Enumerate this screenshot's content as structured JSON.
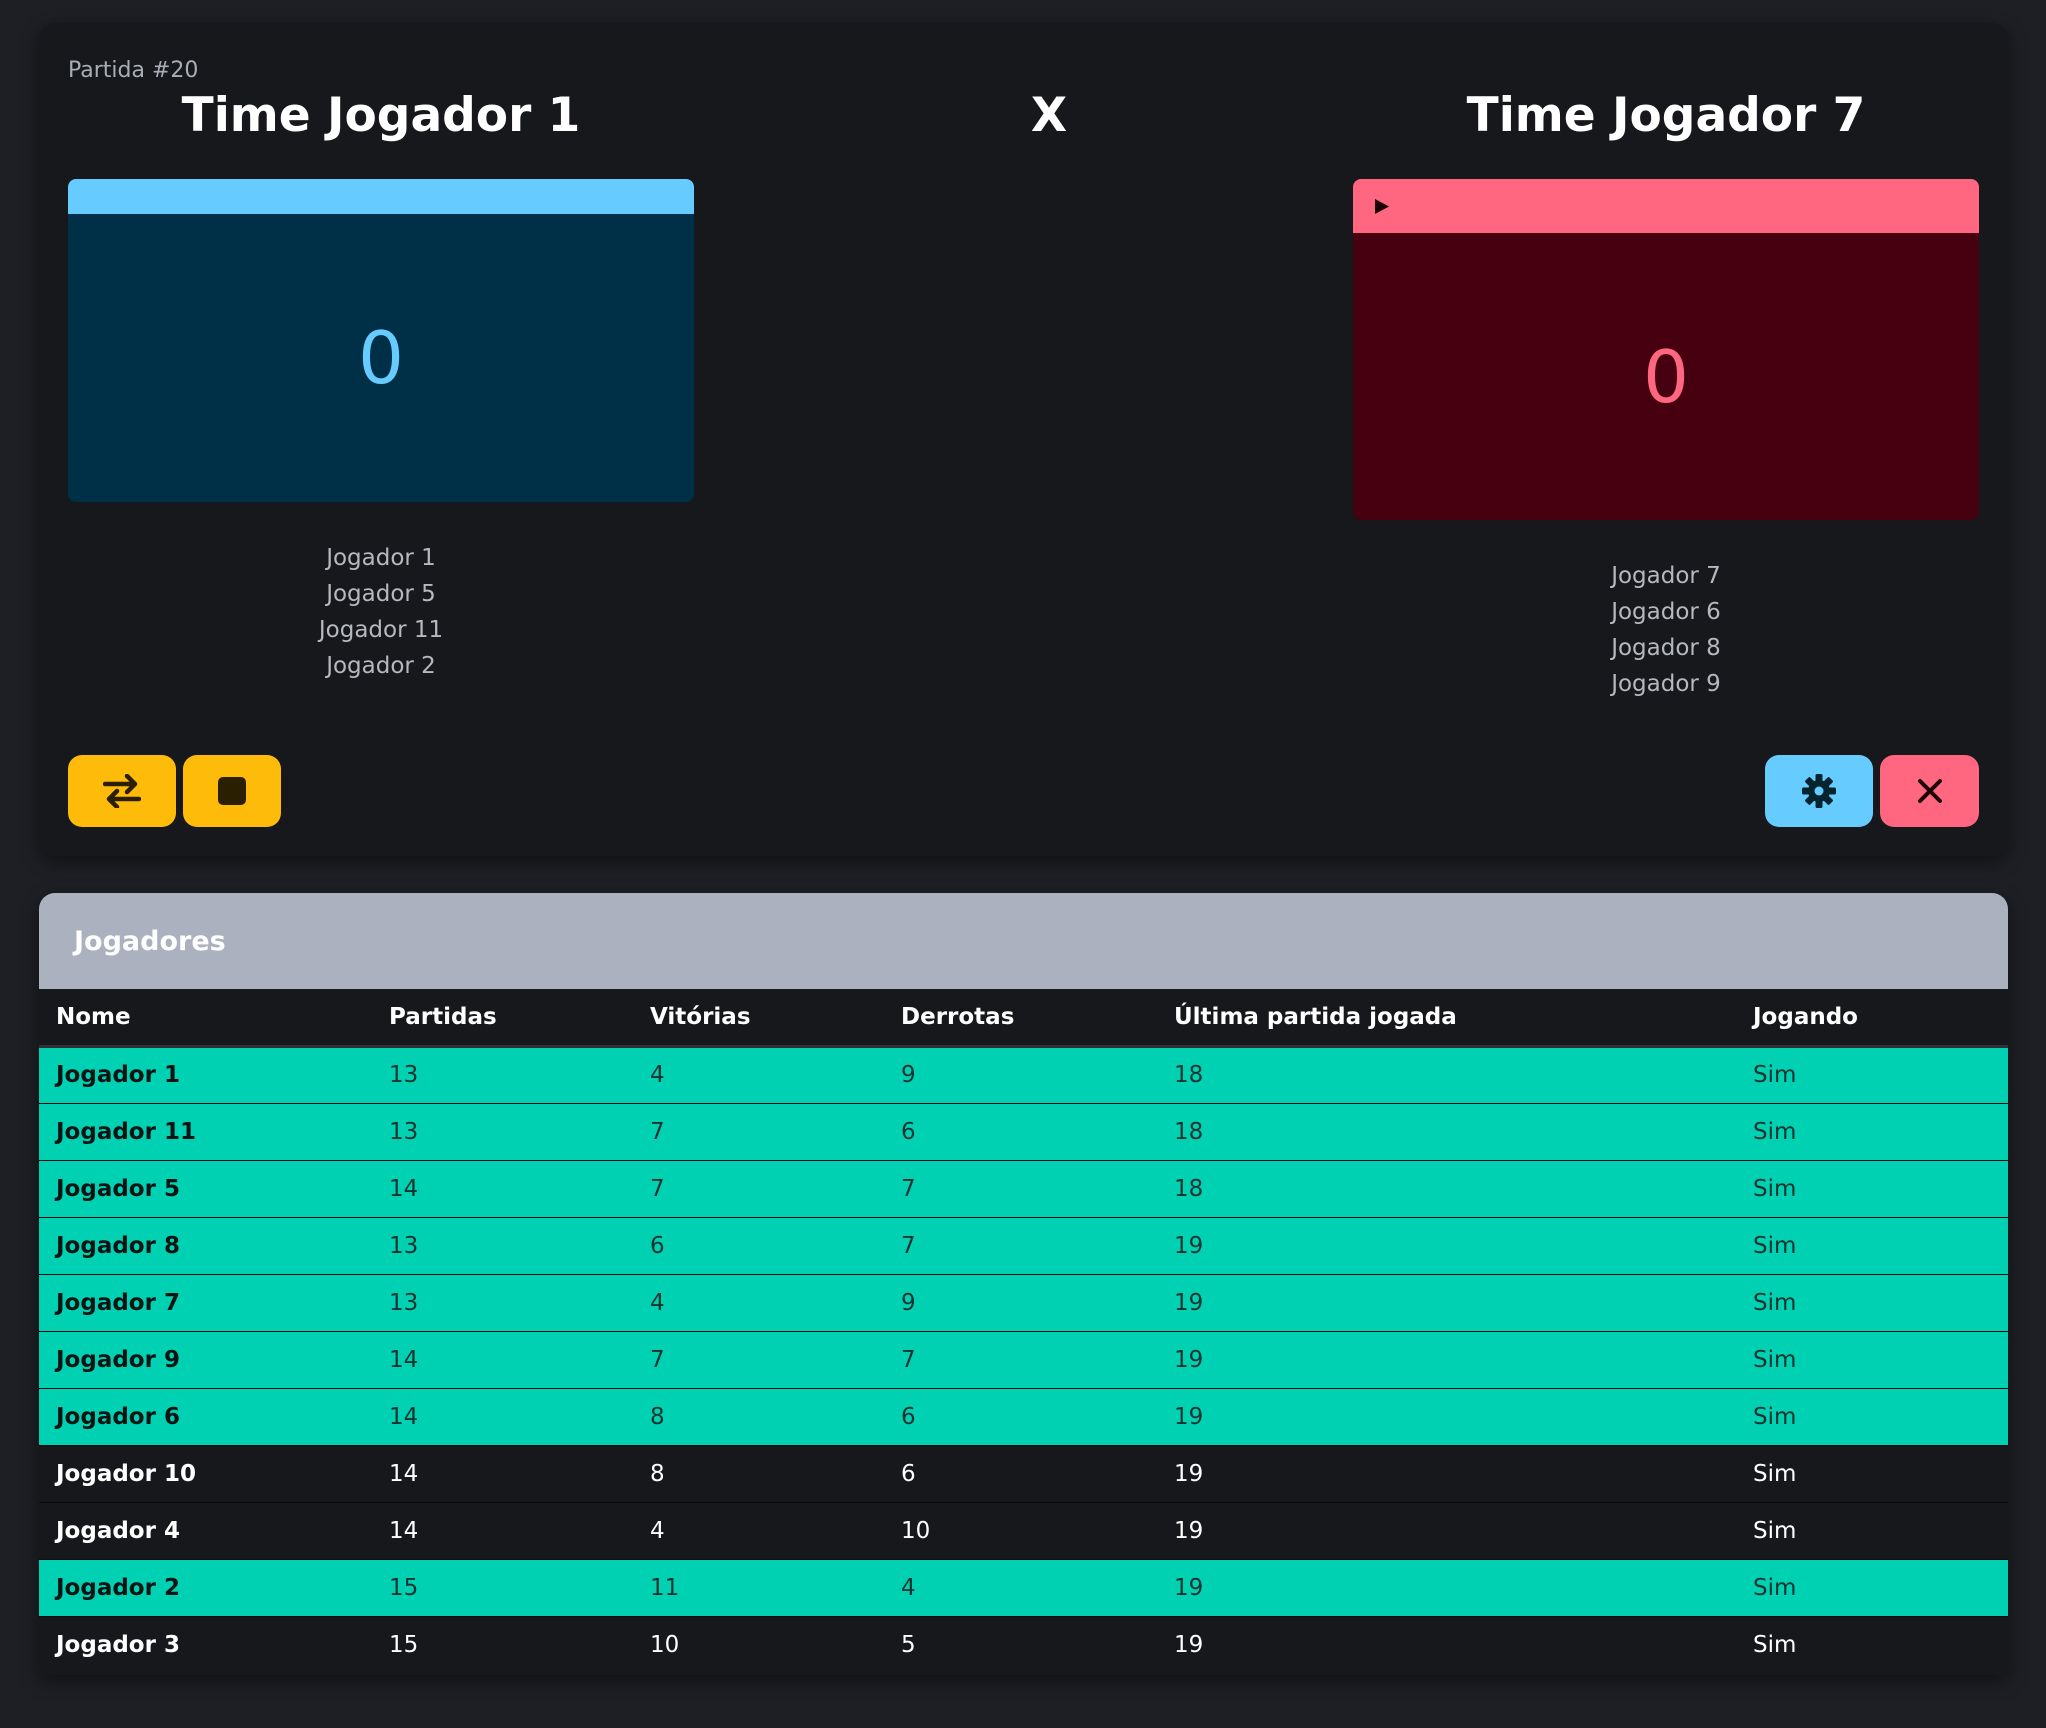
{
  "match": {
    "number_label": "Partida #20",
    "versus_label": "X",
    "team_a": {
      "title": "Time Jogador 1",
      "score": "0",
      "players": [
        "Jogador 1",
        "Jogador 5",
        "Jogador 11",
        "Jogador 2"
      ],
      "bar_color": "#66ccff",
      "body_color": "#003047",
      "score_color": "#66ccff"
    },
    "team_b": {
      "title": "Time Jogador 7",
      "score": "0",
      "serving": true,
      "players": [
        "Jogador 7",
        "Jogador 6",
        "Jogador 8",
        "Jogador 9"
      ],
      "bar_color": "#ff6680",
      "body_color": "#470010",
      "score_color": "#ff6680"
    },
    "buttons": {
      "swap_icon": "swap-arrows-icon",
      "stop_icon": "stop-icon",
      "settings_icon": "gear-icon",
      "close_icon": "close-icon"
    }
  },
  "players_table": {
    "title": "Jogadores",
    "columns": [
      "Nome",
      "Partidas",
      "Vitórias",
      "Derrotas",
      "Última partida jogada",
      "Jogando"
    ],
    "rows": [
      {
        "nome": "Jogador 1",
        "partidas": "13",
        "vitorias": "4",
        "derrotas": "9",
        "ultima": "18",
        "jogando": "Sim",
        "in_match": true
      },
      {
        "nome": "Jogador 11",
        "partidas": "13",
        "vitorias": "7",
        "derrotas": "6",
        "ultima": "18",
        "jogando": "Sim",
        "in_match": true
      },
      {
        "nome": "Jogador 5",
        "partidas": "14",
        "vitorias": "7",
        "derrotas": "7",
        "ultima": "18",
        "jogando": "Sim",
        "in_match": true
      },
      {
        "nome": "Jogador 8",
        "partidas": "13",
        "vitorias": "6",
        "derrotas": "7",
        "ultima": "19",
        "jogando": "Sim",
        "in_match": true
      },
      {
        "nome": "Jogador 7",
        "partidas": "13",
        "vitorias": "4",
        "derrotas": "9",
        "ultima": "19",
        "jogando": "Sim",
        "in_match": true
      },
      {
        "nome": "Jogador 9",
        "partidas": "14",
        "vitorias": "7",
        "derrotas": "7",
        "ultima": "19",
        "jogando": "Sim",
        "in_match": true
      },
      {
        "nome": "Jogador 6",
        "partidas": "14",
        "vitorias": "8",
        "derrotas": "6",
        "ultima": "19",
        "jogando": "Sim",
        "in_match": true
      },
      {
        "nome": "Jogador 10",
        "partidas": "14",
        "vitorias": "8",
        "derrotas": "6",
        "ultima": "19",
        "jogando": "Sim",
        "in_match": false
      },
      {
        "nome": "Jogador 4",
        "partidas": "14",
        "vitorias": "4",
        "derrotas": "10",
        "ultima": "19",
        "jogando": "Sim",
        "in_match": false
      },
      {
        "nome": "Jogador 2",
        "partidas": "15",
        "vitorias": "11",
        "derrotas": "4",
        "ultima": "19",
        "jogando": "Sim",
        "in_match": true
      },
      {
        "nome": "Jogador 3",
        "partidas": "15",
        "vitorias": "10",
        "derrotas": "5",
        "ultima": "19",
        "jogando": "Sim",
        "in_match": false
      }
    ]
  }
}
